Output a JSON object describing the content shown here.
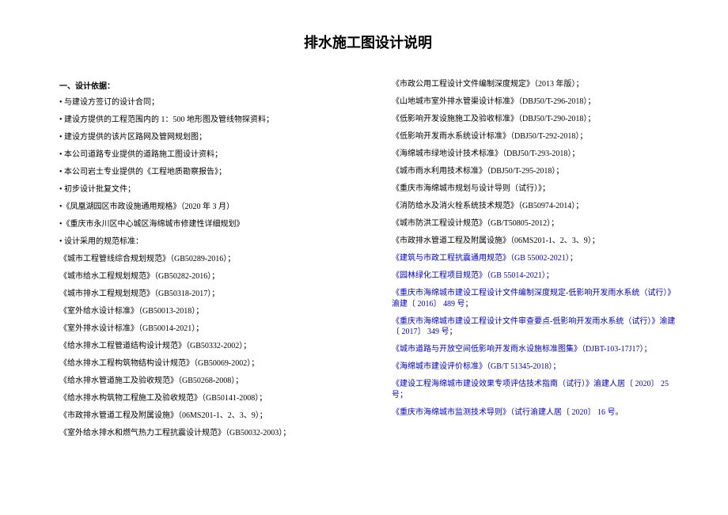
{
  "title": "排水施工图设计说明",
  "heading": "一、设计依据：",
  "left": [
    "• 与建设方签订的设计合同；",
    "• 建设方提供的工程范围内的 1：500 地形图及管线物探资料；",
    "• 建设方提供的该片区路网及管网规划图；",
    "• 本公司道路专业提供的道路施工图设计资料；",
    "• 本公司岩土专业提供的《工程地质勘察报告》；",
    "• 初步设计批复文件；",
    "•《凤凰湖园区市政设施通用规格》（2020 年 3 月）",
    "•《重庆市永川区中心城区海绵城市修建性详细规划》",
    "• 设计采用的规范标准：",
    "《城市工程管线综合规划规范》（GB50289-2016）；",
    "《城市给水工程规划规范》（GB50282-2016）；",
    "《城市排水工程规划规范》（GB50318-2017）；",
    "《室外给水设计标准》（GB50013-2018）；",
    "《室外排水设计标准》（GB50014-2021）；",
    "《给水排水工程管道结构设计规范》（GB50332-2002）；",
    "《给水排水工程构筑物结构设计规范》（GB50069-2002）；",
    "《给水排水管道施工及验收规范》（GB50268-2008）；",
    "《给水排水构筑物工程施工及验收规范》（GB50141-2008）；",
    "《市政排水管道工程及附属设施》（06MS201-1、2、3、9）；",
    "《室外给水排水和燃气热力工程抗震设计规范》（GB50032-2003）；"
  ],
  "right": [
    {
      "t": "《市政公用工程设计文件编制深度规定》（2013 年版）；",
      "b": false
    },
    {
      "t": "《山地城市室外排水管渠设计标准》（DBJ50/T-296-2018）；",
      "b": false
    },
    {
      "t": "《低影响开发设施施工及验收标准》（DBJ50/T-290-2018）；",
      "b": false
    },
    {
      "t": "《低影响开发雨水系统设计标准》（DBJ50/T-292-2018）；",
      "b": false
    },
    {
      "t": "《海绵城市绿地设计技术标准》（DBJ50/T-293-2018）；",
      "b": false
    },
    {
      "t": "《城市雨水利用技术标准》（DBJ50/T-295-2018）；",
      "b": false
    },
    {
      "t": "《重庆市海绵城市规划与设计导则（试行）》；",
      "b": false
    },
    {
      "t": "《消防给水及消火栓系统技术规范》（GB50974-2014）；",
      "b": false
    },
    {
      "t": "《城市防洪工程设计规范》（GB/T50805-2012）；",
      "b": false
    },
    {
      "t": "《市政排水管道工程及附属设施》（06MS201-1、2、3、9）；",
      "b": false
    },
    {
      "t": "《建筑与市政工程抗震通用规范》（GB 55002-2021）；",
      "b": true
    },
    {
      "t": "《园林绿化工程项目规范》（GB 55014-2021）；",
      "b": true
    },
    {
      "t": "《重庆市海绵城市建设工程设计文件编制深度规定-低影响开发雨水系统（试行）》渝建〔 2016〕 489 号；",
      "b": true
    },
    {
      "t": "《重庆市海绵城市建设工程设计文件审查要点-低影响开发雨水系统（试行）》渝建〔 2017〕 349 号；",
      "b": true
    },
    {
      "t": "《城市道路与开放空间低影响开发雨水设施标准图集》（DJBT-103-17J17）；",
      "b": true
    },
    {
      "t": "《海绵城市建设评价标准》（GB/T 51345-2018）；",
      "b": true
    },
    {
      "t": "《建设工程海绵城市建设效果专项评估技术指南（试行）》渝建人居〔 2020〕 25 号；",
      "b": true
    },
    {
      "t": "《重庆市海绵城市监测技术导则》（试行渝建人居〔 2020〕 16 号。",
      "b": true
    }
  ]
}
